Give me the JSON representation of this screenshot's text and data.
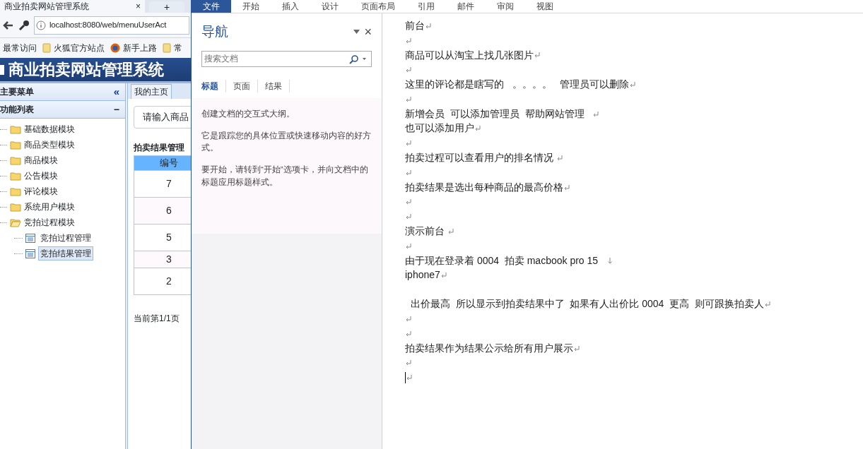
{
  "browser": {
    "tab_title": "商业拍卖网站管理系统",
    "close_glyph": "×",
    "new_tab_glyph": "+",
    "address": "localhost:8080/web/menuUserAct",
    "bookmarks": [
      {
        "label": "最常访问",
        "kind": "plain"
      },
      {
        "label": "火狐官方站点",
        "kind": "folder"
      },
      {
        "label": "新手上路",
        "kind": "globe"
      },
      {
        "label": "常",
        "kind": "folder"
      }
    ]
  },
  "site": {
    "title": "商业拍卖网站管理系统",
    "menu_title": "主要菜单",
    "collapse_glyph": "«",
    "section_title": "功能列表",
    "section_glyph": "−",
    "tree": [
      {
        "label": "基础数据模块",
        "expanded": false
      },
      {
        "label": "商品类型模块",
        "expanded": false
      },
      {
        "label": "商品模块",
        "expanded": false
      },
      {
        "label": "公告模块",
        "expanded": false
      },
      {
        "label": "评论模块",
        "expanded": false
      },
      {
        "label": "系统用户模块",
        "expanded": false
      },
      {
        "label": "竞拍过程模块",
        "expanded": true,
        "children": [
          {
            "label": "竞拍过程管理",
            "selected": false
          },
          {
            "label": "竞拍结果管理",
            "selected": true
          }
        ]
      }
    ],
    "tab": "我的主页",
    "search_placeholder": "请输入商品",
    "table_title": "拍卖结果管理",
    "column": "编号",
    "rows": [
      "7",
      "6",
      "5",
      "3",
      "2"
    ],
    "pager": "当前第1/1页"
  },
  "word": {
    "ribbon_tabs": [
      {
        "label": "文件",
        "selected": true
      },
      {
        "label": "开始",
        "selected": false
      },
      {
        "label": "插入",
        "selected": false
      },
      {
        "label": "设计",
        "selected": false
      },
      {
        "label": "页面布局",
        "selected": false
      },
      {
        "label": "引用",
        "selected": false
      },
      {
        "label": "邮件",
        "selected": false
      },
      {
        "label": "审阅",
        "selected": false
      },
      {
        "label": "视图",
        "selected": false
      }
    ],
    "nav": {
      "title": "导航",
      "close_glyph": "×",
      "search_placeholder": "搜索文档",
      "tabs": [
        {
          "label": "标题",
          "selected": true
        },
        {
          "label": "页面",
          "selected": false
        },
        {
          "label": "结果",
          "selected": false
        }
      ],
      "hints": [
        "创建文档的交互式大纲。",
        "它是跟踪您的具体位置或快速移动内容的好方式。",
        "要开始，请转到“开始”选项卡，并向文档中的标题应用标题样式。"
      ]
    },
    "paragraphs": [
      {
        "text": "前台",
        "kind": "return"
      },
      {
        "kind": "return"
      },
      {
        "text": "商品可以从淘宝上找几张图片",
        "kind": "return"
      },
      {
        "kind": "return"
      },
      {
        "text": "这里的评论都是瞎写的   。。。。   管理员可以删除",
        "kind": "return"
      },
      {
        "kind": "return"
      },
      {
        "text": "新增会员  可以添加管理员  帮助网站管理   ",
        "kind": "return"
      },
      {
        "text": "也可以添加用户",
        "kind": "return"
      },
      {
        "kind": "return"
      },
      {
        "text": "拍卖过程可以查看用户的排名情况 ",
        "kind": "return"
      },
      {
        "kind": "return"
      },
      {
        "text": "拍卖结果是选出每种商品的最高价格",
        "kind": "return"
      },
      {
        "kind": "return"
      },
      {
        "kind": "return"
      },
      {
        "text": "演示前台 ",
        "kind": "return"
      },
      {
        "kind": "return"
      },
      {
        "text": "由于现在登录着 0004  拍卖 macbook pro 15   ",
        "kind": "line-break"
      },
      {
        "text": "iphone7",
        "kind": "return"
      },
      {
        "text": "  出价最高  所以显示到拍卖结果中了  如果有人出价比 0004  更高  则可跟换拍卖人",
        "kind": "return"
      },
      {
        "kind": "return"
      },
      {
        "kind": "return"
      },
      {
        "text": "拍卖结果作为结果公示给所有用户展示",
        "kind": "return"
      },
      {
        "kind": "return"
      },
      {
        "kind": "return"
      }
    ]
  }
}
